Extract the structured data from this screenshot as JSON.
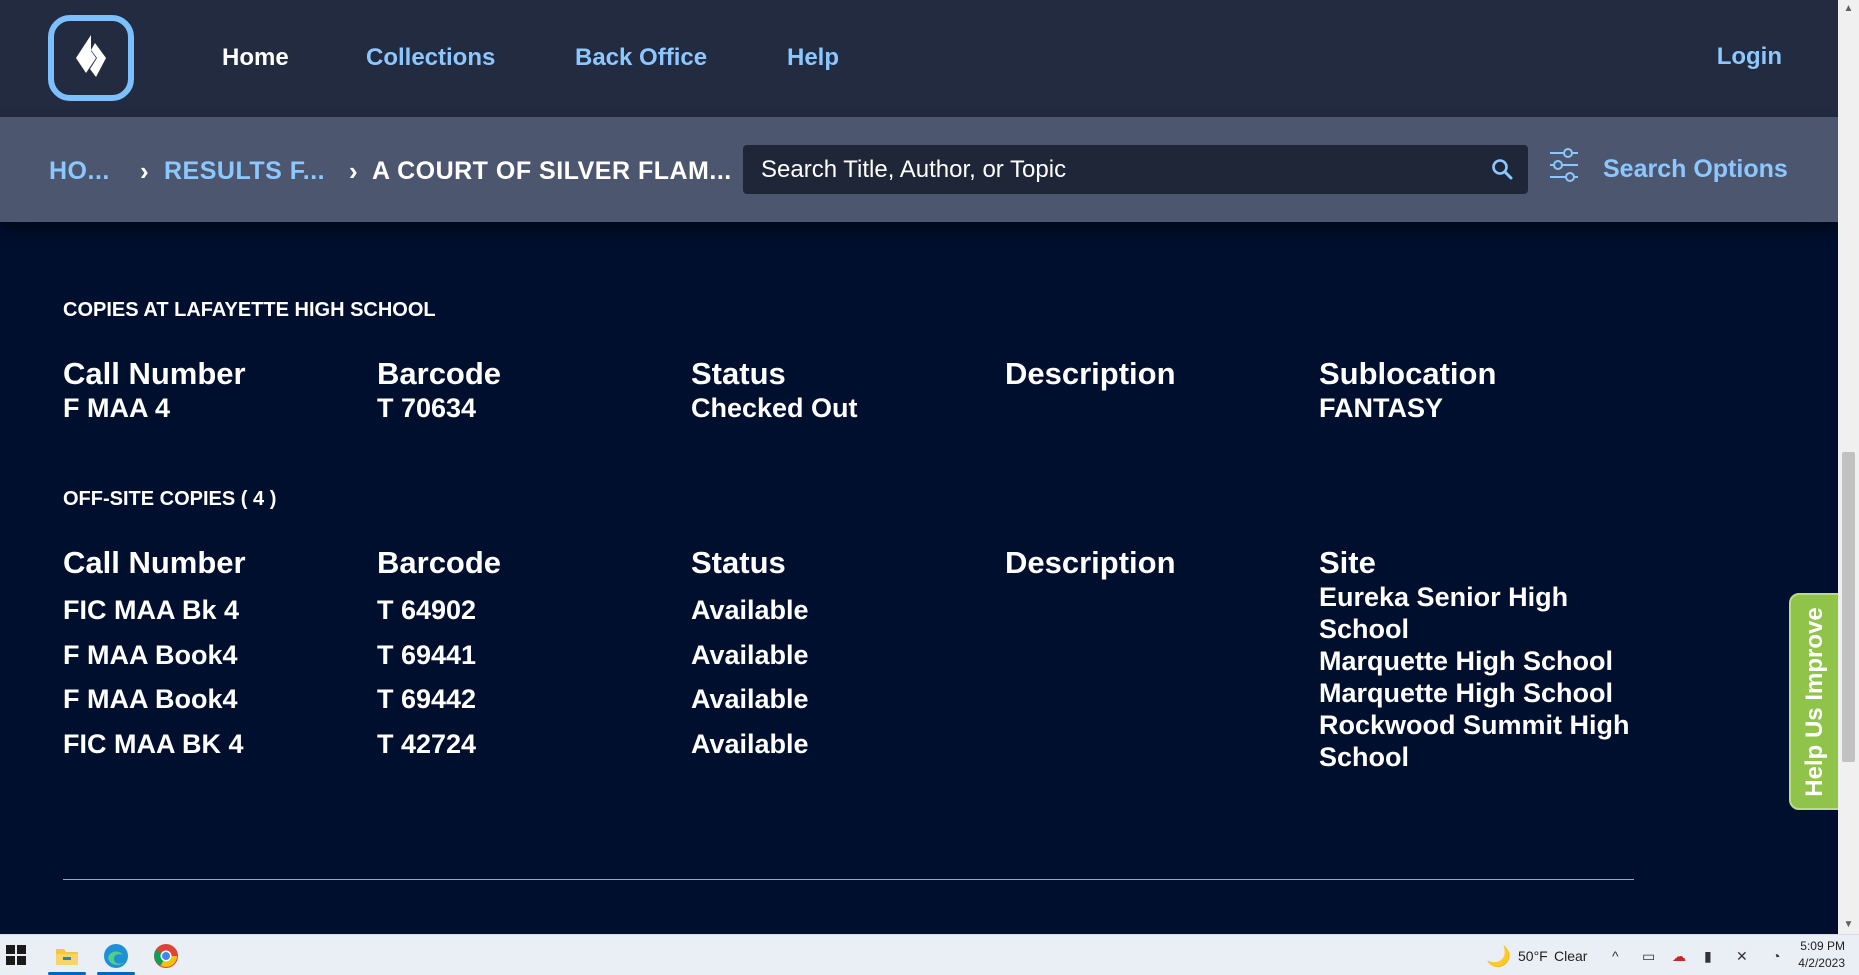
{
  "nav": {
    "items": [
      "Home",
      "Collections",
      "Back Office",
      "Help"
    ],
    "active": "Home",
    "login": "Login"
  },
  "breadcrumb": {
    "items": [
      "HO...",
      "RESULTS F...",
      "A COURT OF SILVER FLAM..."
    ]
  },
  "search": {
    "placeholder": "Search Title, Author, or Topic",
    "options_label": "Search Options"
  },
  "local_copies": {
    "title": "COPIES AT LAFAYETTE HIGH SCHOOL",
    "columns": [
      "Call Number",
      "Barcode",
      "Status",
      "Description",
      "Sublocation"
    ],
    "rows": [
      {
        "call_number": "F MAA 4",
        "barcode": "T 70634",
        "status": "Checked Out",
        "description": "",
        "sublocation": "FANTASY"
      }
    ]
  },
  "offsite_copies": {
    "title": "OFF-SITE COPIES ( 4 )",
    "columns": [
      "Call Number",
      "Barcode",
      "Status",
      "Description",
      "Site"
    ],
    "rows": [
      {
        "call_number": "FIC MAA Bk 4",
        "barcode": "T 64902",
        "status": "Available",
        "description": ""
      },
      {
        "call_number": "F MAA Book4",
        "barcode": "T 69441",
        "status": "Available",
        "description": ""
      },
      {
        "call_number": "F MAA Book4",
        "barcode": "T 69442",
        "status": "Available",
        "description": ""
      },
      {
        "call_number": "FIC MAA BK 4",
        "barcode": "T 42724",
        "status": "Available",
        "description": ""
      }
    ],
    "sites": [
      "Eureka Senior High School",
      "Marquette High School",
      "Marquette High School",
      "Rockwood Summit High School"
    ]
  },
  "feedback_tab": "Help Us Improve",
  "taskbar": {
    "weather_temp": "50°F",
    "weather_desc": "Clear",
    "time": "5:09 PM",
    "date": "4/2/2023"
  },
  "colors": {
    "page_bg": "#000f2e",
    "topbar_bg": "#222b40",
    "subbar_bg": "#4c576f",
    "link": "#8cc7ff",
    "feedback_green": "#8fc34a"
  }
}
